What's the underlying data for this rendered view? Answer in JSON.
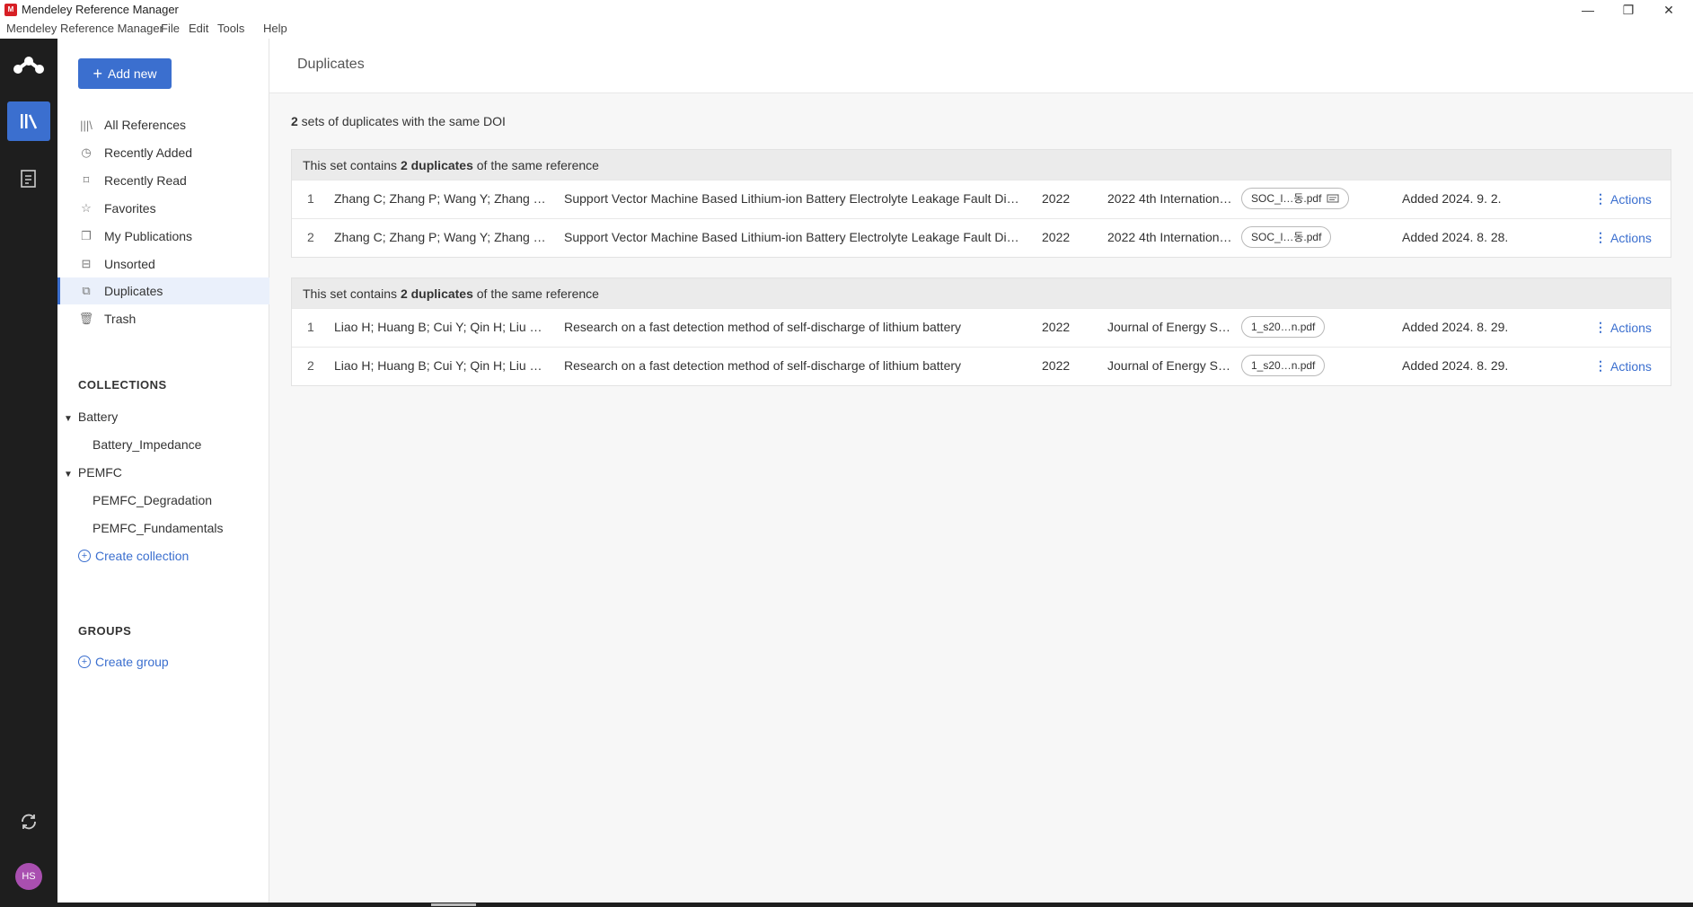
{
  "window": {
    "title": "Mendeley Reference Manager",
    "logo_text": "M",
    "controls": {
      "minimize": "—",
      "restore": "❐",
      "close": "✕"
    }
  },
  "menu": {
    "items": [
      "Mendeley Reference Manager",
      "File",
      "Edit",
      "Tools",
      "Help"
    ]
  },
  "rail": {
    "avatar_initials": "HS",
    "active_color": "#3b6fcf"
  },
  "sidebar": {
    "add_new_label": "Add new",
    "nav": [
      {
        "label": "All References",
        "icon": "library-icon"
      },
      {
        "label": "Recently Added",
        "icon": "clock-icon"
      },
      {
        "label": "Recently Read",
        "icon": "bookmark-icon"
      },
      {
        "label": "Favorites",
        "icon": "star-icon"
      },
      {
        "label": "My Publications",
        "icon": "publication-icon"
      },
      {
        "label": "Unsorted",
        "icon": "inbox-icon"
      },
      {
        "label": "Duplicates",
        "icon": "duplicates-icon",
        "active": true
      },
      {
        "label": "Trash",
        "icon": "trash-icon"
      }
    ],
    "collections_heading": "COLLECTIONS",
    "collections": [
      {
        "label": "Battery",
        "children": [
          "Battery_Impedance"
        ]
      },
      {
        "label": "PEMFC",
        "children": [
          "PEMFC_Degradation",
          "PEMFC_Fundamentals"
        ]
      }
    ],
    "create_collection": "Create collection",
    "groups_heading": "GROUPS",
    "create_group": "Create group"
  },
  "main": {
    "title": "Duplicates",
    "summary_count": "2",
    "summary_text": " sets of duplicates with the same DOI",
    "sets": [
      {
        "head_pre": "This set contains ",
        "head_bold": "2 duplicates",
        "head_post": " of the same reference",
        "rows": [
          {
            "idx": "1",
            "authors": "Zhang C; Zhang P; Wang Y; Zhang L…",
            "title": "Support Vector Machine Based Lithium-ion Battery Electrolyte Leakage Fault Diag…",
            "year": "2022",
            "pub": "2022 4th Internation…",
            "file": "SOC_l…동.pdf",
            "has_note": true,
            "added": "Added 2024. 9. 2.",
            "actions": "Actions"
          },
          {
            "idx": "2",
            "authors": "Zhang C; Zhang P; Wang Y; Zhang L…",
            "title": "Support Vector Machine Based Lithium-ion Battery Electrolyte Leakage Fault Diag…",
            "year": "2022",
            "pub": "2022 4th Internation…",
            "file": "SOC_l…동.pdf",
            "has_note": false,
            "added": "Added 2024. 8. 28.",
            "actions": "Actions"
          }
        ]
      },
      {
        "head_pre": "This set contains ",
        "head_bold": "2 duplicates",
        "head_post": " of the same reference",
        "rows": [
          {
            "idx": "1",
            "authors": "Liao H; Huang B; Cui Y; Qin H; Liu X;…",
            "title": "Research on a fast detection method of self-discharge of lithium battery",
            "year": "2022",
            "pub": "Journal of Energy St…",
            "file": "1_s20…n.pdf",
            "has_note": false,
            "added": "Added 2024. 8. 29.",
            "actions": "Actions"
          },
          {
            "idx": "2",
            "authors": "Liao H; Huang B; Cui Y; Qin H; Liu X;…",
            "title": "Research on a fast detection method of self-discharge of lithium battery",
            "year": "2022",
            "pub": "Journal of Energy St…",
            "file": "1_s20…n.pdf",
            "has_note": false,
            "added": "Added 2024. 8. 29.",
            "actions": "Actions"
          }
        ]
      }
    ]
  }
}
